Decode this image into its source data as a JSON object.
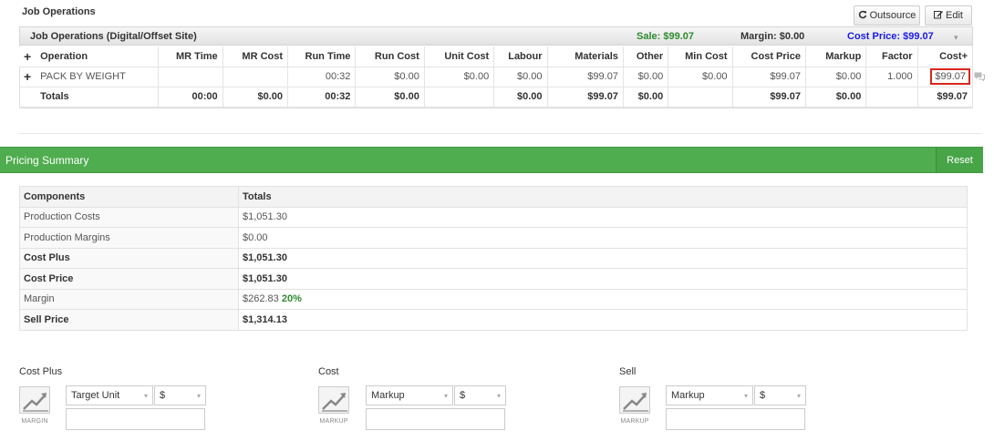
{
  "job_ops": {
    "title": "Job Operations",
    "outsource_label": "Outsource",
    "edit_label": "Edit",
    "panel": {
      "title": "Job Operations (Digital/Offset Site)",
      "sale": "Sale: $99.07",
      "margin": "Margin: $0.00",
      "cost_price": "Cost Price: $99.07"
    },
    "columns": [
      "Operation",
      "MR Time",
      "MR Cost",
      "Run Time",
      "Run Cost",
      "Unit Cost",
      "Labour",
      "Materials",
      "Other",
      "Min Cost",
      "Cost Price",
      "Markup",
      "Factor",
      "Cost+"
    ],
    "rows": [
      {
        "operation": "PACK BY WEIGHT",
        "mr_time": "",
        "mr_cost": "",
        "run_time": "00:32",
        "run_cost": "$0.00",
        "unit_cost": "$0.00",
        "labour": "$0.00",
        "materials": "$99.07",
        "other": "$0.00",
        "min_cost": "$0.00",
        "cost_price": "$99.07",
        "markup": "$0.00",
        "factor": "1.000",
        "cost_plus": "$99.07"
      }
    ],
    "totals": {
      "label": "Totals",
      "mr_time": "00:00",
      "mr_cost": "$0.00",
      "run_time": "00:32",
      "run_cost": "$0.00",
      "unit_cost": "",
      "labour": "$0.00",
      "materials": "$99.07",
      "other": "$0.00",
      "min_cost": "",
      "cost_price": "$99.07",
      "markup": "$0.00",
      "factor": "",
      "cost_plus": "$99.07"
    }
  },
  "pricing_summary": {
    "title": "Pricing Summary",
    "reset_label": "Reset",
    "headers": [
      "Components",
      "Totals"
    ],
    "rows": [
      {
        "label": "Production Costs",
        "value": "$1,051.30"
      },
      {
        "label": "Production Margins",
        "value": "$0.00"
      },
      {
        "label": "Cost Plus",
        "value": "$1,051.30"
      },
      {
        "label": "Cost Price",
        "value": "$1,051.30"
      },
      {
        "label": "Margin",
        "value": "$262.83",
        "percent": "20%"
      },
      {
        "label": "Sell Price",
        "value": "$1,314.13"
      }
    ]
  },
  "controls": [
    {
      "label": "Cost Plus",
      "icon_caption": "MARGIN",
      "mode": "Target Unit",
      "unit": "$",
      "value": ""
    },
    {
      "label": "Cost",
      "icon_caption": "MARKUP",
      "mode": "Markup",
      "unit": "$",
      "value": ""
    },
    {
      "label": "Sell",
      "icon_caption": "MARKUP",
      "mode": "Markup",
      "unit": "$",
      "value": ""
    }
  ],
  "colors": {
    "accent_green": "#4fad4f",
    "sale_green": "#2e8b2e",
    "cost_blue": "#1a1ae6",
    "highlight_red": "#d9261c"
  },
  "icons": [
    "refresh-icon",
    "edit-icon",
    "plus-icon",
    "chart-trend-icon",
    "comment-icon",
    "chevron-down-icon"
  ]
}
